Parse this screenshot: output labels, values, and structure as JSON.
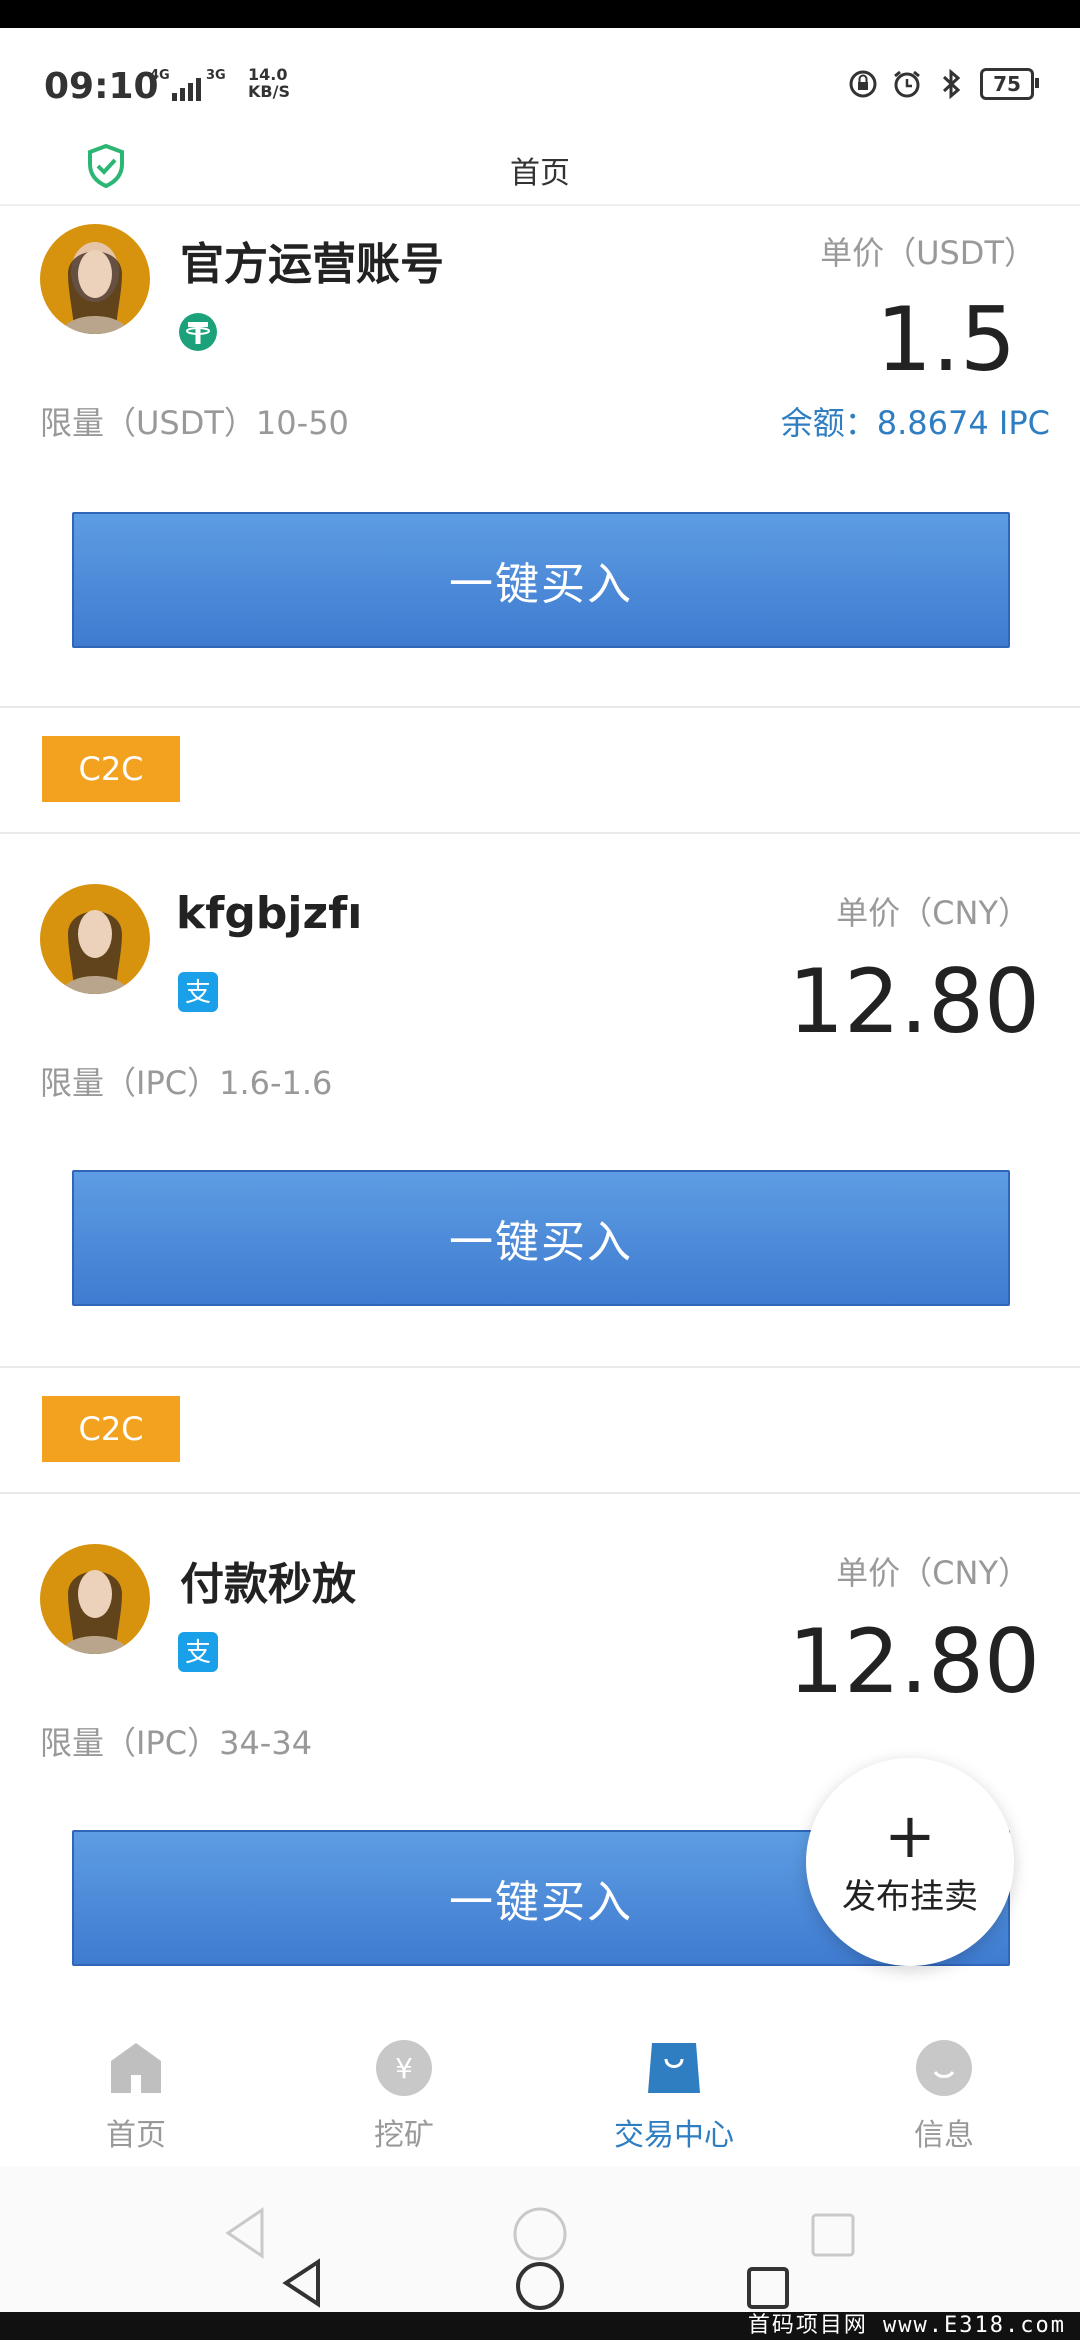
{
  "status_bar": {
    "time": "09:10",
    "net1": "4G",
    "net2": "3G",
    "speed_value": "14.0",
    "speed_unit": "KB/S",
    "battery": "75"
  },
  "header": {
    "title": "首页"
  },
  "official": {
    "name": "官方运营账号",
    "pay_icon": "tether-icon",
    "price_label": "单价（USDT）",
    "price": "1.5",
    "limit": "限量（USDT）10-50",
    "balance": "余额：8.8674 IPC",
    "buy_label": "一键买入"
  },
  "listings": [
    {
      "tag": "C2C",
      "name": "kfgbjzfı",
      "pay_icon": "alipay-icon",
      "price_label": "单价（CNY）",
      "price": "12.80",
      "limit": "限量（IPC）1.6-1.6",
      "buy_label": "一键买入"
    },
    {
      "tag": "C2C",
      "name": "付款秒放",
      "pay_icon": "alipay-icon",
      "price_label": "单价（CNY）",
      "price": "12.80",
      "limit": "限量（IPC）34-34",
      "buy_label": "一键买入"
    }
  ],
  "fab": {
    "icon": "plus-icon",
    "label": "发布挂卖"
  },
  "tabs": [
    {
      "label": "首页",
      "icon": "home-icon"
    },
    {
      "label": "挖矿",
      "icon": "yen-coin-icon"
    },
    {
      "label": "交易中心",
      "icon": "shopping-bag-icon",
      "active": true
    },
    {
      "label": "信息",
      "icon": "smile-icon"
    }
  ],
  "watermark": "首码项目网 www.E318.com",
  "colors": {
    "accent": "#2f7ec2",
    "button": "#4a8ad8",
    "tag": "#f2a21e"
  }
}
